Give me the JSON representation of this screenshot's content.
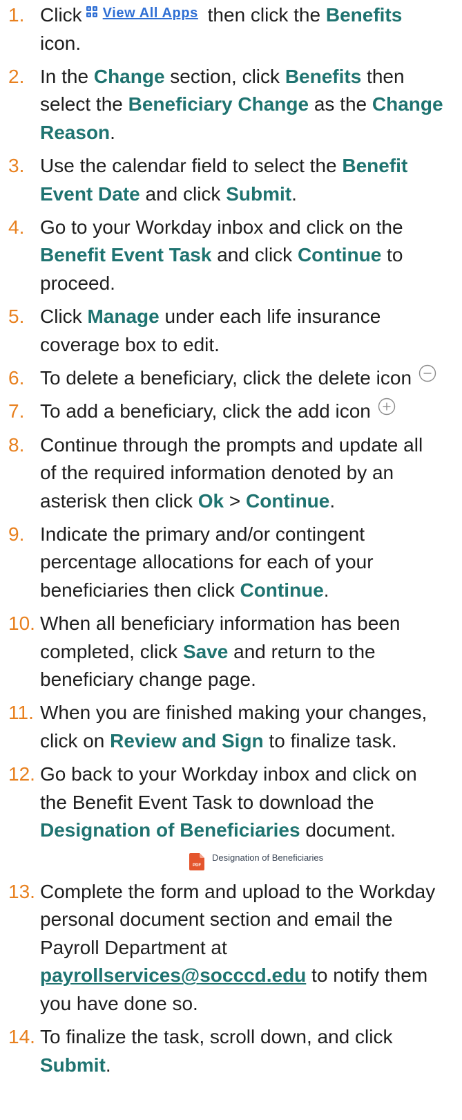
{
  "colors": {
    "text": "#1E1E1E",
    "number": "#E8801E",
    "emphasis": "#1F7370",
    "link_blue": "#2F6FD4",
    "icon_gray": "#8C8C8C",
    "pdf_red": "#E4552D"
  },
  "steps": [
    {
      "number": "1.",
      "icon": "grid-icon",
      "lines": [
        [
          "Click",
          "View All Apps",
          " then click the ",
          "Benefits"
        ],
        [
          "icon."
        ]
      ]
    },
    {
      "number": "2.",
      "lines": [
        [
          "In the ",
          "Change",
          " section, click ",
          "Benefits",
          " then"
        ],
        [
          "select the ",
          "Beneficiary Change",
          " as the ",
          "Change"
        ],
        [
          "Reason",
          "."
        ]
      ]
    },
    {
      "number": "3.",
      "lines": [
        [
          "Use the calendar field to select the ",
          "Benefit"
        ],
        [
          "Event Date",
          " and click ",
          "Submit",
          "."
        ]
      ]
    },
    {
      "number": "4.",
      "lines": [
        [
          "Go to your Workday inbox and click on the"
        ],
        [
          "Benefit Event Task",
          " and click ",
          "Continue",
          " to"
        ],
        [
          "proceed."
        ]
      ]
    },
    {
      "number": "5.",
      "lines": [
        [
          "Click ",
          "Manage",
          " under each life insurance"
        ],
        [
          "coverage box to edit."
        ]
      ]
    },
    {
      "number": "6.",
      "icon": "minus-circle-icon",
      "lines": [
        [
          "To delete a beneficiary, click the delete icon"
        ]
      ]
    },
    {
      "number": "7.",
      "icon": "plus-circle-icon",
      "lines": [
        [
          "To add a beneficiary, click the add icon"
        ]
      ]
    },
    {
      "number": "8.",
      "lines": [
        [
          "Continue through the prompts and update all"
        ],
        [
          "of the required information denoted by an"
        ],
        [
          "asterisk then click ",
          "Ok",
          " > ",
          "Continue",
          "."
        ]
      ]
    },
    {
      "number": "9.",
      "lines": [
        [
          "Indicate the primary and/or contingent"
        ],
        [
          "percentage allocations for each of your"
        ],
        [
          "beneficiaries then click ",
          "Continue",
          "."
        ]
      ]
    },
    {
      "number": "10.",
      "lines": [
        [
          "When all beneficiary information has been"
        ],
        [
          "completed, click ",
          "Save",
          " and return to the"
        ],
        [
          "beneficiary change page."
        ]
      ]
    },
    {
      "number": "11.",
      "lines": [
        [
          "When you are finished making your changes,"
        ],
        [
          "click on ",
          "Review and Sign",
          " to finalize task."
        ]
      ]
    },
    {
      "number": "12.",
      "lines": [
        [
          "Go back to your Workday inbox and click on"
        ],
        [
          "the Benefit Event Task to download the"
        ],
        [
          "Designation of Beneficiaries",
          " document."
        ]
      ]
    },
    {
      "number": "13.",
      "lines": [
        [
          "Complete the form and upload to the Workday"
        ],
        [
          "personal document section and email the"
        ],
        [
          "Payroll Department at"
        ],
        [
          "payrollservices@socccd.edu",
          " to notify them"
        ],
        [
          "you have done so."
        ]
      ]
    },
    {
      "number": "14.",
      "lines": [
        [
          "To finalize the task, scroll down, and click"
        ],
        [
          "Submit",
          "."
        ]
      ]
    }
  ],
  "attachment": {
    "icon": "pdf-file-icon",
    "icon_label": "PDF",
    "file_name": "Designation of Beneficiaries"
  }
}
